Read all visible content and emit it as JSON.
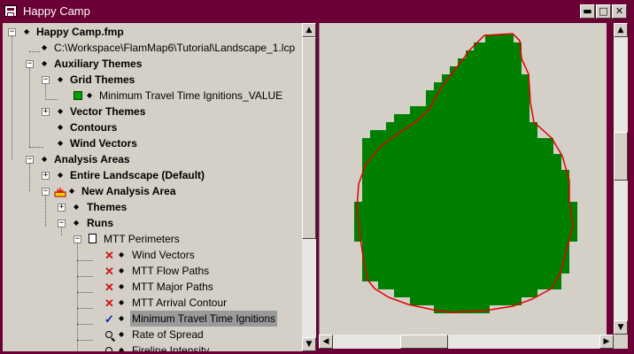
{
  "window": {
    "title": "Happy Camp",
    "minimize_glyph": "▬",
    "maximize_glyph": "□",
    "close_glyph": "✕"
  },
  "tree": {
    "project": "Happy Camp.fmp",
    "landscape_file": "C:\\Workspace\\FlamMap6\\Tutorial\\Landscape_1.lcp",
    "auxiliary_themes": "Auxiliary Themes",
    "grid_themes": "Grid Themes",
    "grid_theme_item": "Minimum Travel Time Ignitions_VALUE",
    "vector_themes": "Vector Themes",
    "contours": "Contours",
    "wind_vectors_aux": "Wind Vectors",
    "analysis_areas": "Analysis Areas",
    "entire_landscape": "Entire Landscape (Default)",
    "new_analysis_area": "New Analysis Area",
    "themes": "Themes",
    "runs": "Runs",
    "mtt_perimeters": "MTT Perimeters",
    "outputs": [
      {
        "label": "Wind Vectors",
        "status": "x"
      },
      {
        "label": "MTT Flow Paths",
        "status": "x"
      },
      {
        "label": "MTT Major Paths",
        "status": "x"
      },
      {
        "label": "MTT Arrival Contour",
        "status": "x"
      },
      {
        "label": "Minimum Travel Time Ignitions",
        "status": "check",
        "selected": true
      },
      {
        "label": "Rate of Spread",
        "status": "magnifier"
      },
      {
        "label": "Fireline Intensity",
        "status": "magnifier"
      }
    ]
  },
  "map": {
    "fill_color": "#008000",
    "perimeter_color": "#e00000",
    "background": "#d4d0c8"
  },
  "colors": {
    "titlebar": "#6b0036",
    "selection": "#9a9a9a"
  }
}
